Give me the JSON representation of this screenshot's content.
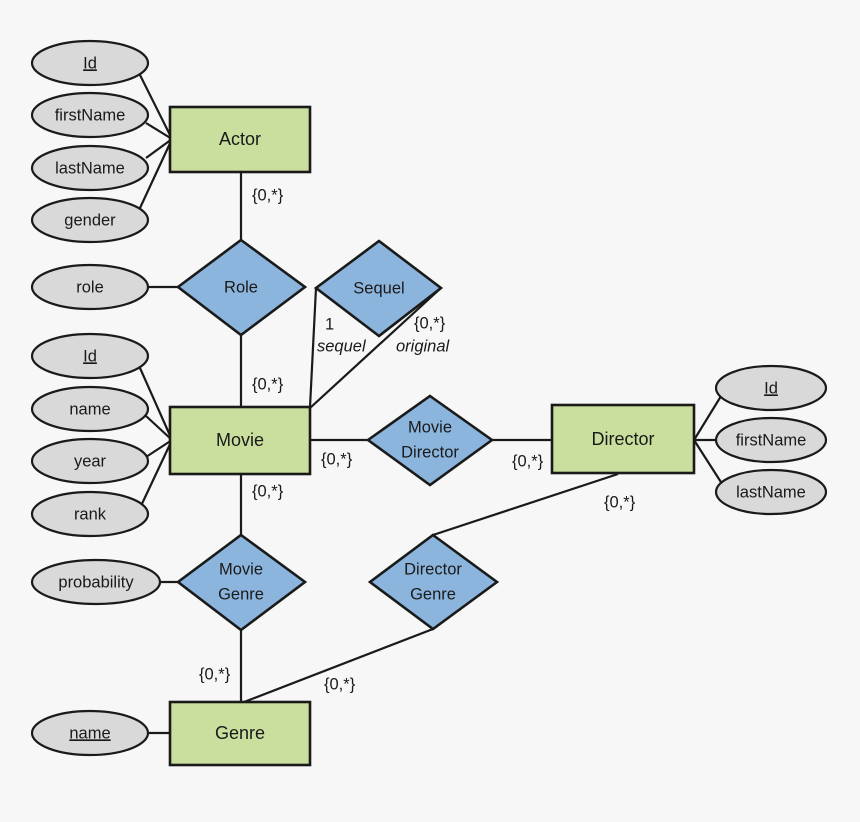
{
  "diagram": {
    "kind": "entity-relationship-diagram",
    "background_color": "#f7f7f7",
    "colors": {
      "entity_fill": "#cadf9e",
      "relationship_fill": "#8cb5de",
      "attribute_fill": "#d9d9d9",
      "stroke": "#1a1a1a"
    }
  },
  "entities": [
    {
      "id": "actor",
      "label": "Actor"
    },
    {
      "id": "movie",
      "label": "Movie"
    },
    {
      "id": "director",
      "label": "Director"
    },
    {
      "id": "genre",
      "label": "Genre"
    }
  ],
  "relationships": [
    {
      "id": "role",
      "line1": "Role",
      "line2": ""
    },
    {
      "id": "sequel",
      "line1": "Sequel",
      "line2": ""
    },
    {
      "id": "movie-director",
      "line1": "Movie",
      "line2": "Director"
    },
    {
      "id": "movie-genre",
      "line1": "Movie",
      "line2": "Genre"
    },
    {
      "id": "director-genre",
      "line1": "Director",
      "line2": "Genre"
    }
  ],
  "attributes": [
    {
      "id": "actor-id",
      "label": "Id",
      "key": true,
      "owner": "actor"
    },
    {
      "id": "actor-firstname",
      "label": "firstName",
      "key": false,
      "owner": "actor"
    },
    {
      "id": "actor-lastname",
      "label": "lastName",
      "key": false,
      "owner": "actor"
    },
    {
      "id": "actor-gender",
      "label": "gender",
      "key": false,
      "owner": "actor"
    },
    {
      "id": "role-role",
      "label": "role",
      "key": false,
      "owner": "role"
    },
    {
      "id": "movie-id",
      "label": "Id",
      "key": true,
      "owner": "movie"
    },
    {
      "id": "movie-name",
      "label": "name",
      "key": false,
      "owner": "movie"
    },
    {
      "id": "movie-year",
      "label": "year",
      "key": false,
      "owner": "movie"
    },
    {
      "id": "movie-rank",
      "label": "rank",
      "key": false,
      "owner": "movie"
    },
    {
      "id": "director-id",
      "label": "Id",
      "key": true,
      "owner": "director"
    },
    {
      "id": "director-firstname",
      "label": "firstName",
      "key": false,
      "owner": "director"
    },
    {
      "id": "director-lastname",
      "label": "lastName",
      "key": false,
      "owner": "director"
    },
    {
      "id": "moviegenre-probability",
      "label": "probability",
      "key": false,
      "owner": "movie-genre"
    },
    {
      "id": "genre-name",
      "label": "name",
      "key": true,
      "owner": "genre"
    }
  ],
  "cardinalities": {
    "actor_role": "{0,*}",
    "movie_role": "{0,*}",
    "sequel_sequel": "1",
    "sequel_original": "{0,*}",
    "movie_moviedirector": "{0,*}",
    "director_moviedirector": "{0,*}",
    "movie_moviegenre": "{0,*}",
    "genre_moviegenre": "{0,*}",
    "director_directorgenre": "{0,*}",
    "genre_directorgenre": "{0,*}"
  },
  "role_names": {
    "sequel_side": "sequel",
    "original_side": "original"
  }
}
